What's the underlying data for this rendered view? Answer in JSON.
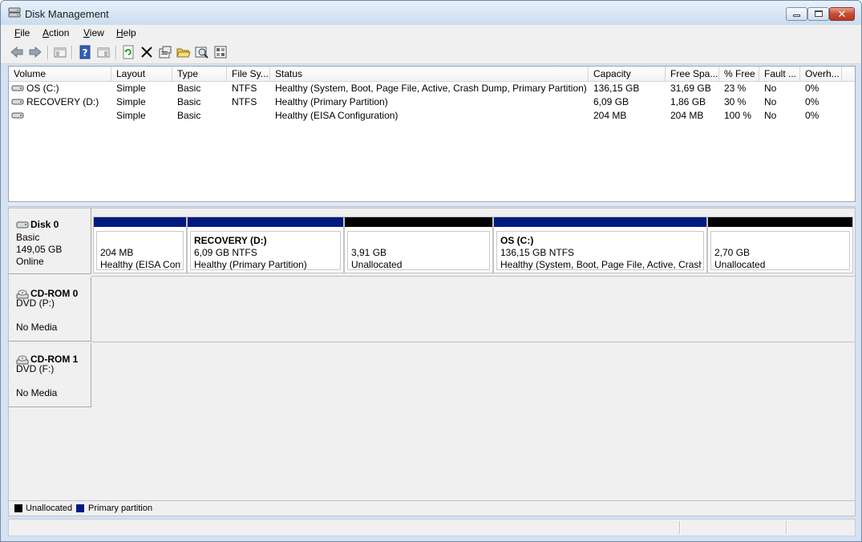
{
  "window": {
    "title": "Disk Management"
  },
  "menu": [
    {
      "label": "File",
      "accel": "F",
      "rest": "ile"
    },
    {
      "label": "Action",
      "accel": "A",
      "rest": "ction"
    },
    {
      "label": "View",
      "accel": "V",
      "rest": "iew"
    },
    {
      "label": "Help",
      "accel": "H",
      "rest": "elp"
    }
  ],
  "toolbar": {
    "buttons": [
      "back-arrow-icon",
      "forward-arrow-icon",
      "show-hide-console-tree-icon",
      "help-icon",
      "show-hide-action-pane-icon",
      "refresh-icon",
      "delete-icon",
      "properties-icon",
      "open-icon",
      "rescan-disks-icon",
      "disk-list-icon"
    ]
  },
  "volumes": {
    "columns": [
      "Volume",
      "Layout",
      "Type",
      "File Sy...",
      "Status",
      "Capacity",
      "Free Spa...",
      "% Free",
      "Fault ...",
      "Overh..."
    ],
    "rows": [
      {
        "volume": "OS (C:)",
        "layout": "Simple",
        "type": "Basic",
        "fs": "NTFS",
        "status": "Healthy (System, Boot, Page File, Active, Crash Dump, Primary Partition)",
        "capacity": "136,15 GB",
        "free": "31,69 GB",
        "pct": "23 %",
        "fault": "No",
        "overhead": "0%"
      },
      {
        "volume": "RECOVERY (D:)",
        "layout": "Simple",
        "type": "Basic",
        "fs": "NTFS",
        "status": "Healthy (Primary Partition)",
        "capacity": "6,09 GB",
        "free": "1,86 GB",
        "pct": "30 %",
        "fault": "No",
        "overhead": "0%"
      },
      {
        "volume": "",
        "layout": "Simple",
        "type": "Basic",
        "fs": "",
        "status": "Healthy (EISA Configuration)",
        "capacity": "204 MB",
        "free": "204 MB",
        "pct": "100 %",
        "fault": "No",
        "overhead": "0%"
      }
    ]
  },
  "disks": [
    {
      "name": "Disk 0",
      "line1": "Basic",
      "line2": "149,05 GB",
      "line3": "Online",
      "partitions": [
        {
          "title": "",
          "size": "204 MB",
          "status": "Healthy (EISA Configuration)",
          "kind": "primary"
        },
        {
          "title": "RECOVERY  (D:)",
          "size": "6,09 GB NTFS",
          "status": "Healthy (Primary Partition)",
          "kind": "primary"
        },
        {
          "title": "",
          "size": "3,91 GB",
          "status": "Unallocated",
          "kind": "unalloc"
        },
        {
          "title": "OS  (C:)",
          "size": "136,15 GB NTFS",
          "status": "Healthy (System, Boot, Page File, Active, Crash Dump, Primary Partition)",
          "kind": "primary"
        },
        {
          "title": "",
          "size": "2,70 GB",
          "status": "Unallocated",
          "kind": "unalloc"
        }
      ]
    },
    {
      "name": "CD-ROM 0",
      "line1": "DVD (P:)",
      "line2": "",
      "line3": "No Media"
    },
    {
      "name": "CD-ROM 1",
      "line1": "DVD (F:)",
      "line2": "",
      "line3": "No Media"
    }
  ],
  "legend": [
    {
      "label": "Unallocated",
      "color": "#000000"
    },
    {
      "label": "Primary partition",
      "color": "#001a7f"
    }
  ]
}
